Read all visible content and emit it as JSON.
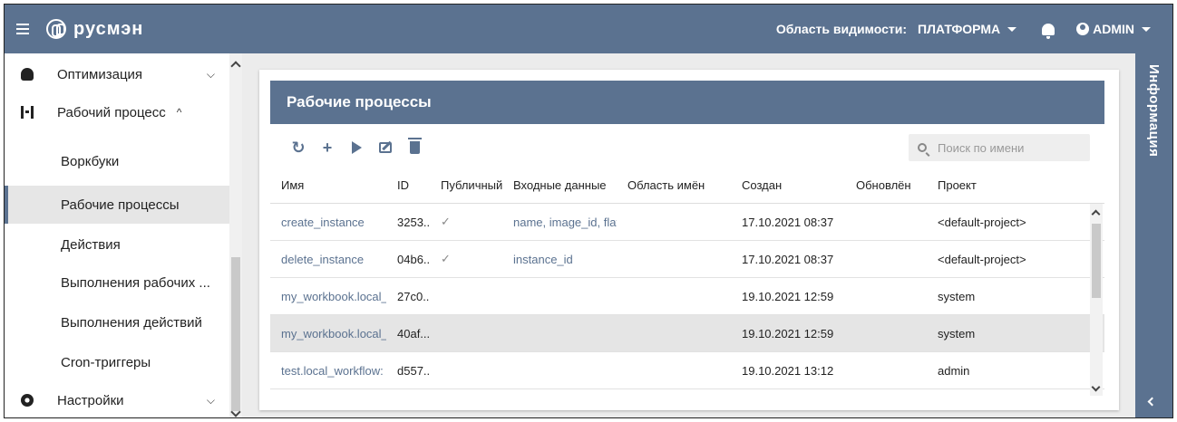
{
  "header": {
    "logo_text": "русмэн",
    "scope_label": "Область видимости:",
    "scope_value": "ПЛАТФОРМА",
    "user": "ADMIN"
  },
  "sidebar": {
    "items": [
      {
        "label": "Оптимизация",
        "chevron": "⌵"
      },
      {
        "label": "Рабочий процесс",
        "chevron": "^"
      },
      {
        "label": "Воркбуки"
      },
      {
        "label": "Рабочие процессы"
      },
      {
        "label": "Действия"
      },
      {
        "label": "Выполнения рабочих ..."
      },
      {
        "label": "Выполнения действий"
      },
      {
        "label": "Cron-триггеры"
      },
      {
        "label": "Настройки",
        "chevron": "⌵"
      }
    ]
  },
  "panel": {
    "title": "Рабочие процессы",
    "toolbar": {
      "refresh": "↻",
      "add": "+"
    },
    "search_placeholder": "Поиск по имени",
    "columns": [
      "Имя",
      "ID",
      "Публичный",
      "Входные данные",
      "Область имён",
      "Создан",
      "Обновлён",
      "Проект"
    ],
    "rows": [
      {
        "name": "create_instance",
        "id": "3253...",
        "public": "✓",
        "input": "name, image_id, flavor",
        "namespace": "",
        "created": "17.10.2021 08:37",
        "updated": "",
        "project": "<default-project>"
      },
      {
        "name": "delete_instance",
        "id": "04b6...",
        "public": "✓",
        "input": "instance_id",
        "namespace": "",
        "created": "17.10.2021 08:37",
        "updated": "",
        "project": "<default-project>"
      },
      {
        "name": "my_workbook.local_",
        "id": "27c0...",
        "public": "",
        "input": "",
        "namespace": "",
        "created": "19.10.2021 12:59",
        "updated": "",
        "project": "system"
      },
      {
        "name": "my_workbook.local_",
        "id": "40af...",
        "public": "",
        "input": "",
        "namespace": "",
        "created": "19.10.2021 12:59",
        "updated": "",
        "project": "system"
      },
      {
        "name": "test.local_workflow:",
        "id": "d557...",
        "public": "",
        "input": "",
        "namespace": "",
        "created": "19.10.2021 13:12",
        "updated": "",
        "project": "admin"
      }
    ]
  },
  "info": {
    "label": "Информация"
  }
}
